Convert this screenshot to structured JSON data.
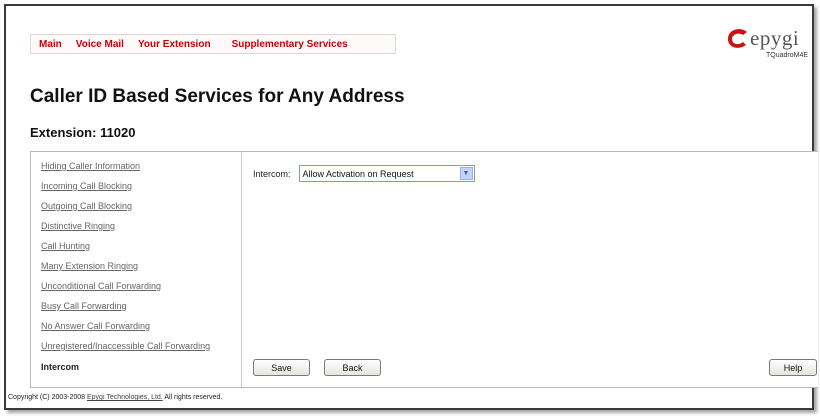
{
  "tabs": [
    "Main",
    "Voice Mail",
    "Your Extension",
    "Supplementary Services"
  ],
  "logo": {
    "word": "epygi",
    "model": "TQuadroM4E"
  },
  "page_title": "Caller ID Based Services for Any Address",
  "extension_title": "Extension: 11020",
  "nav_items": [
    "Hiding Caller Information",
    "Incoming Call Blocking",
    "Outgoing Call Blocking",
    "Distinctive Ringing",
    "Call Hunting",
    "Many Extension Ringing",
    "Unconditional Call Forwarding",
    "Busy Call Forwarding",
    "No Answer Call Forwarding",
    "Unregistered/Inaccessible Call Forwarding",
    "Intercom"
  ],
  "active_nav": "Intercom",
  "form": {
    "intercom_label": "Intercom:",
    "intercom_value": "Allow Activation on Request"
  },
  "buttons": {
    "save": "Save",
    "back": "Back",
    "help": "Help"
  },
  "footer": {
    "prefix": "Copyright (C) 2003-2008 ",
    "company": "Epygi Technologies, Ltd.",
    "suffix": " All rights reserved."
  },
  "colors": {
    "tab_text": "#cc0000",
    "logo_red": "#cc1111",
    "border": "#3a3a3a"
  }
}
